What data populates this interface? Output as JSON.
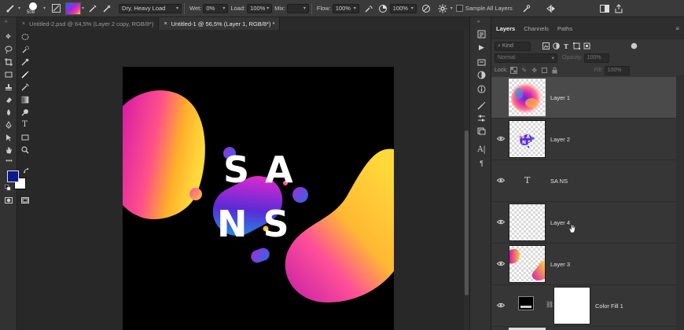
{
  "options_bar": {
    "brush_size": "508",
    "preset": "Dry, Heavy Load",
    "wet_label": "Wet:",
    "wet_value": "0%",
    "load_label": "Load:",
    "load_value": "100%",
    "mix_label": "Mix:",
    "mix_value": "",
    "flow_label": "Flow:",
    "flow_value": "100%",
    "pressure_value": "100%",
    "sample_all_layers": "Sample All Layers"
  },
  "tabs": [
    {
      "label": "Untitled-2.psd @ 64,5% (Layer 2 copy, RGB/8*)",
      "close": "×"
    },
    {
      "label": "Untitled-1 @ 56,5% (Layer 1, RGB/8*) *",
      "close": "×",
      "active": true
    }
  ],
  "artwork": {
    "line1": "S A",
    "line2": "N S"
  },
  "layers_panel": {
    "tabs": [
      "Layers",
      "Channels",
      "Paths"
    ],
    "menu": "≡",
    "filter_kind": "Kind",
    "blend_mode": "Normal",
    "opacity_label": "Opacity:",
    "opacity_value": "100%",
    "lock_label": "Lock:",
    "fill_label": "Fill:",
    "fill_value": "100%",
    "layers": [
      {
        "name": "Layer 1",
        "selected": true,
        "visible": false
      },
      {
        "name": "Layer 2",
        "visible": true
      },
      {
        "name": "SA NS",
        "type": "text",
        "visible": true
      },
      {
        "name": "Layer 4",
        "visible": true
      },
      {
        "name": "Layer 3",
        "visible": true
      },
      {
        "name": "Color Fill 1",
        "type": "fill",
        "visible": true
      }
    ]
  },
  "colors": {
    "foreground": "#0a1a8c",
    "background": "#ffffff",
    "accent_blob_yellow": "#f7c21a",
    "accent_blob_magenta": "#d61aa8"
  }
}
